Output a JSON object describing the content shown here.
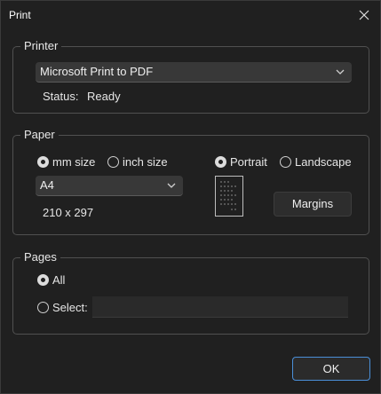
{
  "window": {
    "title": "Print"
  },
  "printer": {
    "legend": "Printer",
    "selected": "Microsoft Print to PDF",
    "status_label": "Status:",
    "status_value": "Ready"
  },
  "paper": {
    "legend": "Paper",
    "unit_mm": "mm size",
    "unit_inch": "inch size",
    "unit_selected": "mm",
    "size_selected": "A4",
    "dimensions": "210 x 297",
    "orient_portrait": "Portrait",
    "orient_landscape": "Landscape",
    "orient_selected": "portrait",
    "margins_button": "Margins"
  },
  "pages": {
    "legend": "Pages",
    "all_label": "All",
    "select_label": "Select:",
    "select_value": "",
    "selected": "all"
  },
  "footer": {
    "ok_button": "OK"
  },
  "icons": {
    "close": "close-icon",
    "dropdown": "chevron-down-icon",
    "page_preview": "page-portrait-icon"
  },
  "colors": {
    "background": "#202020",
    "accent": "#4a8fd8"
  }
}
